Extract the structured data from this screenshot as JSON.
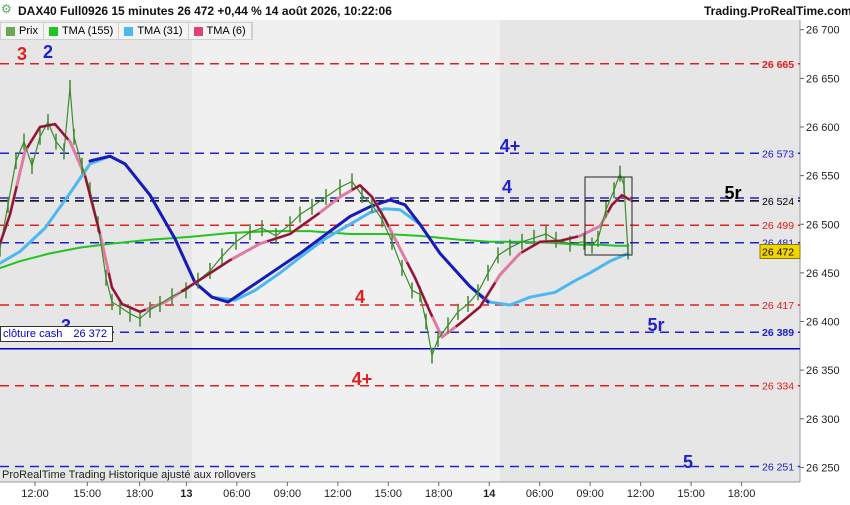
{
  "header": {
    "title": "DAX40 Full0926 15 minutes 26 472 +0,44 % 14 août 2026, 10:22:06",
    "site": "Trading.ProRealTime.com"
  },
  "legend": [
    {
      "label": "Prix",
      "color": "#6aa84f"
    },
    {
      "label": "TMA (155)",
      "color": "#22c422"
    },
    {
      "label": "TMA (31)",
      "color": "#4db8f0"
    },
    {
      "label": "TMA (6)",
      "color": "#e0407a"
    }
  ],
  "footer": "ProRealTime Trading  Historique ajusté aux rollovers",
  "close_label": {
    "text": "clôture cash",
    "value": "26 372"
  },
  "chart_data": {
    "type": "line",
    "instrument": "DAX40 Full0926",
    "timeframe": "15 minutes",
    "ylim": [
      26235,
      26710
    ],
    "y_ticks": [
      26250,
      26300,
      26350,
      26400,
      26450,
      26500,
      26550,
      26600,
      26650,
      26700
    ],
    "y_tick_labels": [
      "26 250",
      "26 300",
      "26 350",
      "26 400",
      "26 450",
      "26 500",
      "26 550",
      "26 600",
      "26 650",
      "26 700"
    ],
    "x_tick_labels": [
      "12:00",
      "15:00",
      "18:00",
      "13",
      "06:00",
      "09:00",
      "12:00",
      "15:00",
      "18:00",
      "14",
      "06:00",
      "09:00",
      "12:00",
      "15:00",
      "18:00"
    ],
    "levels": [
      {
        "value": 26665,
        "label": "26 665",
        "color": "#e02020",
        "style": "dash",
        "bold": true
      },
      {
        "value": 26573,
        "label": "26 573",
        "color": "#2020cc",
        "style": "dash"
      },
      {
        "value": 26527,
        "label": "26 527",
        "color": "#2020cc",
        "style": "dash"
      },
      {
        "value": 26524,
        "label": "26 524",
        "color": "#000000",
        "style": "dash"
      },
      {
        "value": 26499,
        "label": "26 499",
        "color": "#e02020",
        "style": "dash"
      },
      {
        "value": 26481,
        "label": "26 481",
        "color": "#2020cc",
        "style": "dash"
      },
      {
        "value": 26417,
        "label": "26 417",
        "color": "#e02020",
        "style": "dash"
      },
      {
        "value": 26389,
        "label": "26 389",
        "color": "#2020cc",
        "style": "dash",
        "bold": true
      },
      {
        "value": 26372,
        "label": "",
        "color": "#0000cc",
        "style": "solid"
      },
      {
        "value": 26334,
        "label": "26 334",
        "color": "#e02020",
        "style": "dash"
      },
      {
        "value": 26251,
        "label": "26 251",
        "color": "#2020cc",
        "style": "dash"
      }
    ],
    "last_price": {
      "value": 26472,
      "label": "26 472"
    },
    "annotations": [
      {
        "text": "3",
        "color": "#e02020"
      },
      {
        "text": "2",
        "color": "#2020cc"
      },
      {
        "text": "4+",
        "color": "#2020cc"
      },
      {
        "text": "4",
        "color": "#2020cc"
      },
      {
        "text": "5r",
        "color": "#000000"
      },
      {
        "text": "4",
        "color": "#e02020"
      },
      {
        "text": "3",
        "color": "#2020cc"
      },
      {
        "text": "5r",
        "color": "#2020cc"
      },
      {
        "text": "4+",
        "color": "#e02020"
      },
      {
        "text": "5",
        "color": "#2020cc"
      }
    ],
    "series": [
      {
        "name": "TMA (155)",
        "color": "#22c422",
        "points": [
          [
            0,
            26455
          ],
          [
            20,
            26462
          ],
          [
            50,
            26470
          ],
          [
            80,
            26476
          ],
          [
            110,
            26480
          ],
          [
            150,
            26484
          ],
          [
            190,
            26487
          ],
          [
            230,
            26491
          ],
          [
            270,
            26493
          ],
          [
            310,
            26493
          ],
          [
            350,
            26490
          ],
          [
            385,
            26490
          ],
          [
            420,
            26488
          ],
          [
            460,
            26484
          ],
          [
            490,
            26482
          ],
          [
            520,
            26482
          ],
          [
            550,
            26481
          ],
          [
            580,
            26479
          ],
          [
            600,
            26479
          ],
          [
            616,
            26478
          ],
          [
            628,
            26478
          ]
        ]
      },
      {
        "name": "TMA (31)",
        "color": "#4db8f0",
        "points": [
          [
            0,
            26460
          ],
          [
            20,
            26472
          ],
          [
            45,
            26496
          ],
          [
            70,
            26532
          ],
          [
            90,
            26562
          ],
          [
            110,
            26570
          ],
          [
            125,
            26562
          ],
          [
            150,
            26530
          ],
          [
            175,
            26485
          ],
          [
            195,
            26440
          ],
          [
            212,
            26425
          ],
          [
            235,
            26422
          ],
          [
            255,
            26432
          ],
          [
            280,
            26450
          ],
          [
            300,
            26466
          ],
          [
            325,
            26485
          ],
          [
            350,
            26500
          ],
          [
            370,
            26512
          ],
          [
            385,
            26516
          ],
          [
            400,
            26515
          ],
          [
            420,
            26500
          ],
          [
            440,
            26470
          ],
          [
            470,
            26436
          ],
          [
            490,
            26420
          ],
          [
            510,
            26417
          ],
          [
            530,
            26425
          ],
          [
            555,
            26430
          ],
          [
            575,
            26442
          ],
          [
            590,
            26450
          ],
          [
            610,
            26462
          ],
          [
            628,
            26470
          ]
        ]
      },
      {
        "name": "TMA",
        "color": "#1a1ab8",
        "points": [
          [
            90,
            26565
          ],
          [
            110,
            26570
          ],
          [
            125,
            26562
          ],
          [
            150,
            26530
          ],
          [
            175,
            26485
          ],
          [
            195,
            26440
          ],
          [
            212,
            26425
          ],
          [
            228,
            26420
          ],
          [
            300,
            26470
          ],
          [
            350,
            26508
          ],
          [
            370,
            26518
          ],
          [
            390,
            26525
          ],
          [
            405,
            26520
          ],
          [
            420,
            26500
          ],
          [
            440,
            26470
          ],
          [
            470,
            26436
          ],
          [
            488,
            26420
          ]
        ]
      },
      {
        "name": "TMA (6)",
        "color": "#e07aa0",
        "points": [
          [
            0,
            26480
          ],
          [
            10,
            26510
          ],
          [
            25,
            26575
          ],
          [
            40,
            26600
          ],
          [
            55,
            26603
          ],
          [
            70,
            26585
          ],
          [
            85,
            26550
          ],
          [
            100,
            26490
          ],
          [
            112,
            26435
          ],
          [
            122,
            26418
          ],
          [
            140,
            26410
          ],
          [
            165,
            26420
          ],
          [
            200,
            26443
          ],
          [
            230,
            26463
          ],
          [
            260,
            26480
          ],
          [
            290,
            26490
          ],
          [
            320,
            26512
          ],
          [
            340,
            26528
          ],
          [
            360,
            26540
          ],
          [
            372,
            26528
          ],
          [
            385,
            26505
          ],
          [
            400,
            26475
          ],
          [
            415,
            26445
          ],
          [
            430,
            26410
          ],
          [
            442,
            26384
          ],
          [
            460,
            26398
          ],
          [
            480,
            26415
          ],
          [
            500,
            26448
          ],
          [
            520,
            26470
          ],
          [
            540,
            26482
          ],
          [
            560,
            26483
          ],
          [
            580,
            26488
          ],
          [
            600,
            26498
          ],
          [
            612,
            26520
          ],
          [
            622,
            26530
          ],
          [
            630,
            26525
          ]
        ]
      },
      {
        "name": "Prix",
        "color": "#3f8a2e",
        "points": [
          [
            0,
            26475
          ],
          [
            8,
            26520
          ],
          [
            16,
            26565
          ],
          [
            24,
            26585
          ],
          [
            32,
            26560
          ],
          [
            40,
            26590
          ],
          [
            48,
            26605
          ],
          [
            56,
            26585
          ],
          [
            64,
            26575
          ],
          [
            70,
            26640
          ],
          [
            74,
            26590
          ],
          [
            82,
            26560
          ],
          [
            90,
            26535
          ],
          [
            98,
            26500
          ],
          [
            106,
            26445
          ],
          [
            112,
            26420
          ],
          [
            120,
            26415
          ],
          [
            130,
            26408
          ],
          [
            140,
            26403
          ],
          [
            150,
            26412
          ],
          [
            160,
            26418
          ],
          [
            172,
            26426
          ],
          [
            186,
            26432
          ],
          [
            198,
            26442
          ],
          [
            210,
            26452
          ],
          [
            222,
            26467
          ],
          [
            236,
            26482
          ],
          [
            250,
            26492
          ],
          [
            262,
            26496
          ],
          [
            276,
            26488
          ],
          [
            290,
            26500
          ],
          [
            300,
            26510
          ],
          [
            312,
            26518
          ],
          [
            326,
            26528
          ],
          [
            340,
            26538
          ],
          [
            352,
            26544
          ],
          [
            362,
            26530
          ],
          [
            372,
            26520
          ],
          [
            382,
            26505
          ],
          [
            392,
            26482
          ],
          [
            402,
            26455
          ],
          [
            412,
            26432
          ],
          [
            420,
            26428
          ],
          [
            426,
            26400
          ],
          [
            432,
            26365
          ],
          [
            438,
            26382
          ],
          [
            448,
            26396
          ],
          [
            458,
            26410
          ],
          [
            468,
            26418
          ],
          [
            478,
            26430
          ],
          [
            488,
            26450
          ],
          [
            498,
            26468
          ],
          [
            510,
            26476
          ],
          [
            522,
            26482
          ],
          [
            534,
            26486
          ],
          [
            546,
            26490
          ],
          [
            556,
            26484
          ],
          [
            570,
            26480
          ],
          [
            584,
            26482
          ],
          [
            592,
            26478
          ],
          [
            598,
            26485
          ],
          [
            606,
            26515
          ],
          [
            614,
            26535
          ],
          [
            620,
            26552
          ],
          [
            624,
            26540
          ],
          [
            628,
            26472
          ]
        ]
      }
    ]
  }
}
